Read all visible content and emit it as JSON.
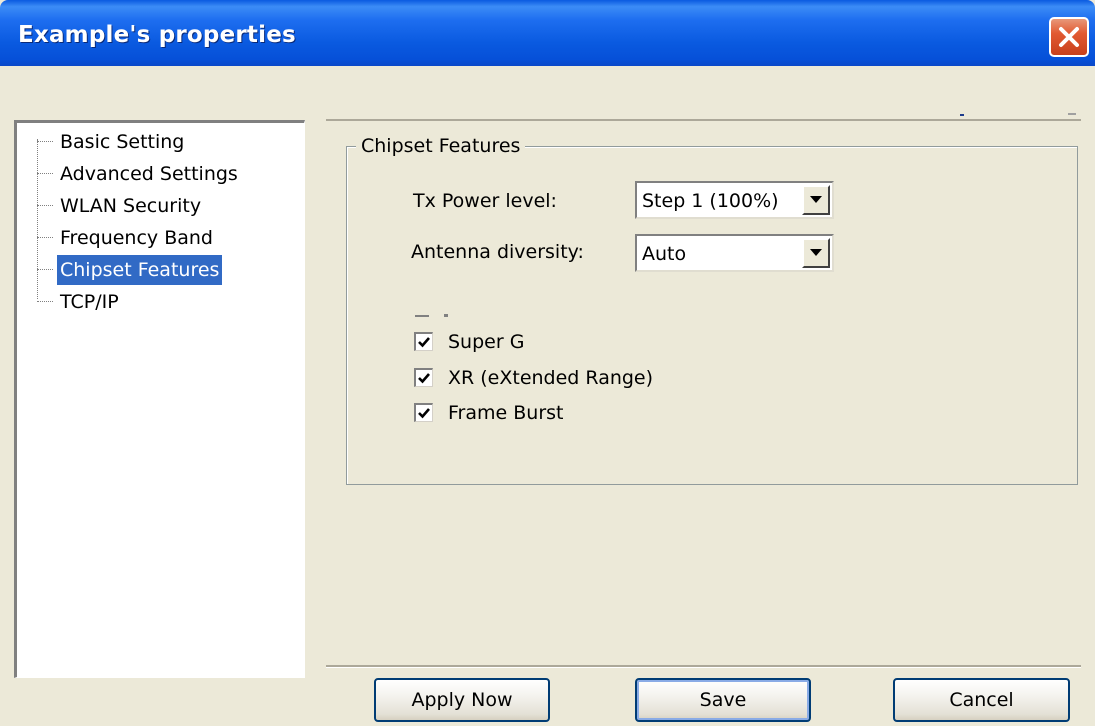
{
  "window": {
    "title": "Example's properties"
  },
  "tree": {
    "items": [
      {
        "label": "Basic Setting",
        "selected": false
      },
      {
        "label": "Advanced Settings",
        "selected": false
      },
      {
        "label": "WLAN Security",
        "selected": false
      },
      {
        "label": "Frequency Band",
        "selected": false
      },
      {
        "label": "Chipset Features",
        "selected": true
      },
      {
        "label": "TCP/IP",
        "selected": false
      }
    ]
  },
  "group": {
    "title": "Chipset Features",
    "tx_power": {
      "label": "Tx Power level:",
      "value": "Step 1 (100%)"
    },
    "antenna": {
      "label": "Antenna diversity:",
      "value": "Auto"
    },
    "checkboxes": [
      {
        "label": "Super G",
        "checked": true
      },
      {
        "label": "XR (eXtended Range)",
        "checked": true
      },
      {
        "label": "Frame Burst",
        "checked": true
      }
    ]
  },
  "buttons": {
    "apply": "Apply Now",
    "save": "Save",
    "cancel": "Cancel"
  },
  "icons": {
    "close": "close-icon",
    "dropdown": "chevron-down-icon",
    "check": "check-icon"
  },
  "colors": {
    "titlebar": "#0a5ae0",
    "selection": "#316ac5",
    "close_button": "#e25a32",
    "dialog_bg": "#ece9d8"
  }
}
